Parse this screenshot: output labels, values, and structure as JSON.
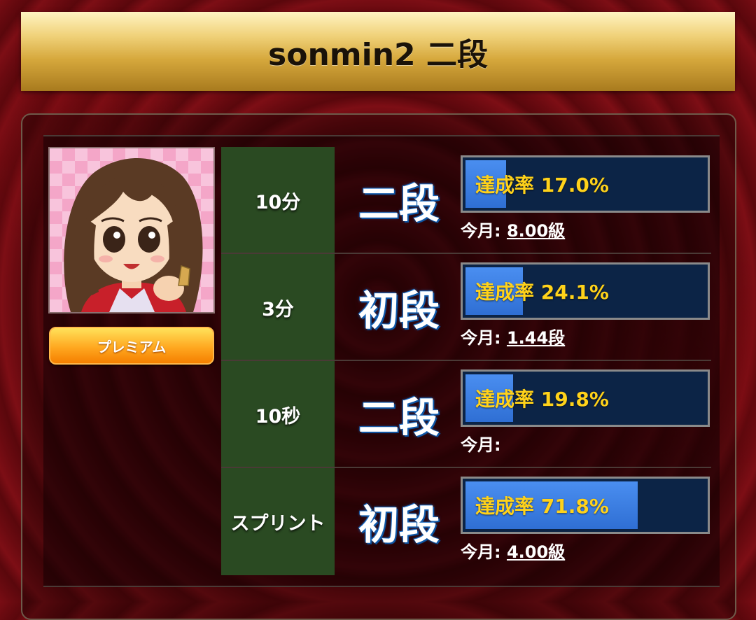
{
  "header": {
    "title": "sonmin2 二段"
  },
  "profile": {
    "badge_label": "プレミアム"
  },
  "rows": [
    {
      "mode": "10分",
      "rank": "二段",
      "rate_label": "達成率 17.0%",
      "rate_percent": 17.0,
      "month_label": "今月:",
      "month_value": "8.00級"
    },
    {
      "mode": "3分",
      "rank": "初段",
      "rate_label": "達成率 24.1%",
      "rate_percent": 24.1,
      "month_label": "今月:",
      "month_value": "1.44段"
    },
    {
      "mode": "10秒",
      "rank": "二段",
      "rate_label": "達成率 19.8%",
      "rate_percent": 19.8,
      "month_label": "今月:",
      "month_value": ""
    },
    {
      "mode": "スプリント",
      "rank": "初段",
      "rate_label": "達成率 71.8%",
      "rate_percent": 71.8,
      "month_label": "今月:",
      "month_value": "4.00級"
    }
  ],
  "colors": {
    "gold": "#d6a83c",
    "bar_fill": "#2f6fd4",
    "rate_text": "#ffd21a",
    "green_col": "#2a4a22"
  }
}
